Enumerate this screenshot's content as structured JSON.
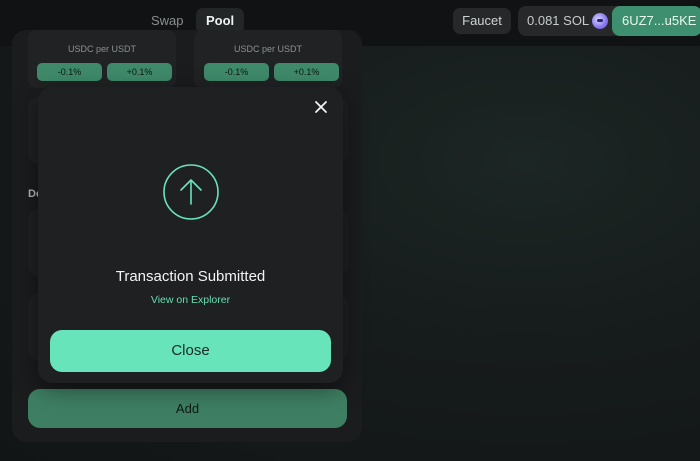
{
  "nav": {
    "swap_label": "Swap",
    "pool_label": "Pool"
  },
  "header": {
    "faucet_label": "Faucet",
    "balance_label": "0.081 SOL",
    "wallet_label": "6UZ7...u5KE"
  },
  "pool": {
    "left_pair_label": "USDC per USDT",
    "right_pair_label": "USDC per USDT",
    "minus_label": "-0.1%",
    "plus_label": "+0.1%",
    "deposit_label": "De",
    "add_label": "Add"
  },
  "modal": {
    "title": "Transaction Submitted",
    "link_label": "View on Explorer",
    "close_button_label": "Close",
    "icon": "arrow-up-circle-icon",
    "close_icon": "close-icon"
  },
  "colors": {
    "accent": "#68e4bb",
    "accent_dark": "#3e8f6f",
    "link": "#67dcb4"
  }
}
